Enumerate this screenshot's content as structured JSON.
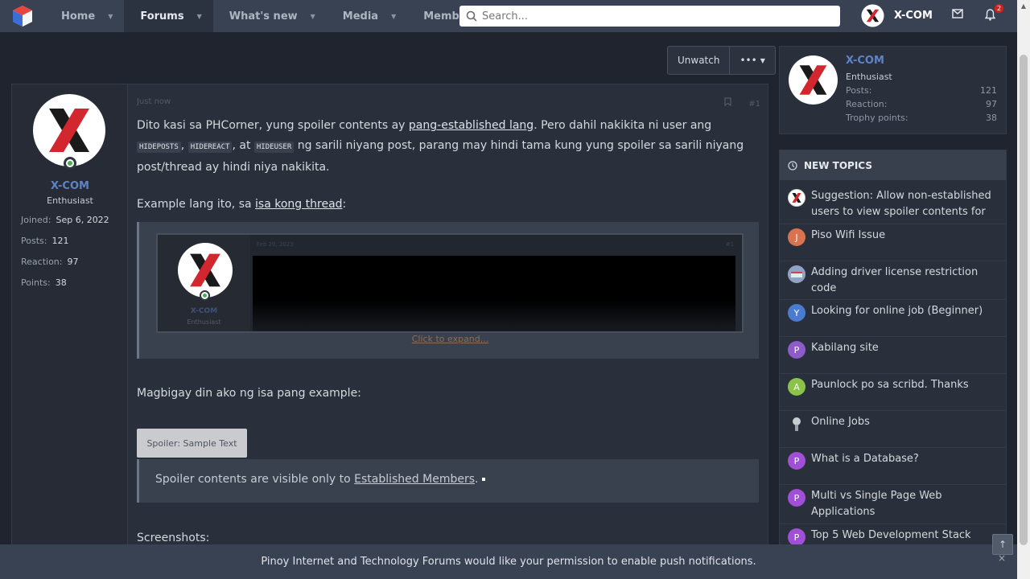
{
  "nav": {
    "items": [
      {
        "label": "Home"
      },
      {
        "label": "Forums"
      },
      {
        "label": "What's new"
      },
      {
        "label": "Media"
      },
      {
        "label": "Members"
      }
    ],
    "search_placeholder": "Search...",
    "username": "X-COM",
    "alerts_count": "2"
  },
  "thread_actions": {
    "unwatch": "Unwatch",
    "more": "•••"
  },
  "post": {
    "user": {
      "name": "X-COM",
      "title": "Enthusiast",
      "joined_label": "Joined:",
      "joined": "Sep 6, 2022",
      "posts_label": "Posts:",
      "posts": "121",
      "reaction_label": "Reaction:",
      "reaction": "97",
      "points_label": "Points:",
      "points": "38"
    },
    "time": "Just now",
    "number": "#1",
    "p1": {
      "a": "Dito kasi sa PHCorner, yung spoiler contents ay ",
      "link": "pang-established lang",
      "b": ". Pero dahil nakikita ni user ang",
      "code1": "HIDEPOSTS",
      "c": ", ",
      "code2": "HIDEREACT",
      "d": ", at ",
      "code3": "HIDEUSER",
      "e": " ng sarili niyang post, parang may hindi tama kung yung spoiler sa sarili niyang",
      "f": "post/thread ay hindi niya nakikita."
    },
    "p2": {
      "a": "Example lang ito, sa ",
      "link": "isa kong thread",
      "b": ":"
    },
    "embed": {
      "name": "X-COM",
      "title": "Enthusiast",
      "date": "Feb 20, 2023",
      "number": "#1",
      "expand": "Click to expand..."
    },
    "p3": "Magbigay din ako ng isa pang example:",
    "spoiler_button": "Spoiler: Sample Text",
    "spoiler_text": "Spoiler contents are visible only to ",
    "spoiler_link": "Established Members",
    "spoiler_end": ".",
    "p4": "Screenshots:"
  },
  "sidebar_user": {
    "name": "X-COM",
    "title": "Enthusiast",
    "stats": [
      {
        "label": "Posts:",
        "value": "121"
      },
      {
        "label": "Reaction:",
        "value": "97"
      },
      {
        "label": "Trophy points:",
        "value": "38"
      }
    ]
  },
  "new_topics": {
    "heading": "NEW TOPICS",
    "items": [
      {
        "title": "Suggestion: Allow non-established users to view spoiler contents for",
        "initial": "",
        "color": "#ffffff"
      },
      {
        "title": "Piso Wifi Issue",
        "initial": "J",
        "color": "#d9734f"
      },
      {
        "title": "Adding driver license restriction code",
        "initial": "",
        "color": "#8fa3c4"
      },
      {
        "title": "Looking for online job (Beginner)",
        "initial": "Y",
        "color": "#4a7bd1"
      },
      {
        "title": "Kabilang site",
        "initial": "P",
        "color": "#8e5bc9"
      },
      {
        "title": "Paunlock po sa scribd. Thanks",
        "initial": "A",
        "color": "#8bc34a"
      },
      {
        "title": "Online Jobs",
        "initial": "",
        "color": "#2a303b"
      },
      {
        "title": "What is a Database?",
        "initial": "P",
        "color": "#a04fd6"
      },
      {
        "title": "Multi vs Single Page Web Applications",
        "initial": "P",
        "color": "#a04fd6"
      },
      {
        "title": "Top 5 Web Development Stack",
        "initial": "P",
        "color": "#a04fd6"
      }
    ]
  },
  "notice": {
    "text": "Pinoy Internet and Technology Forums would like your permission to enable push notifications.",
    "close": "×"
  },
  "colors": {
    "accent": "#5d83c9",
    "nav_bg": "#394253",
    "page_bg": "#1f242e"
  }
}
